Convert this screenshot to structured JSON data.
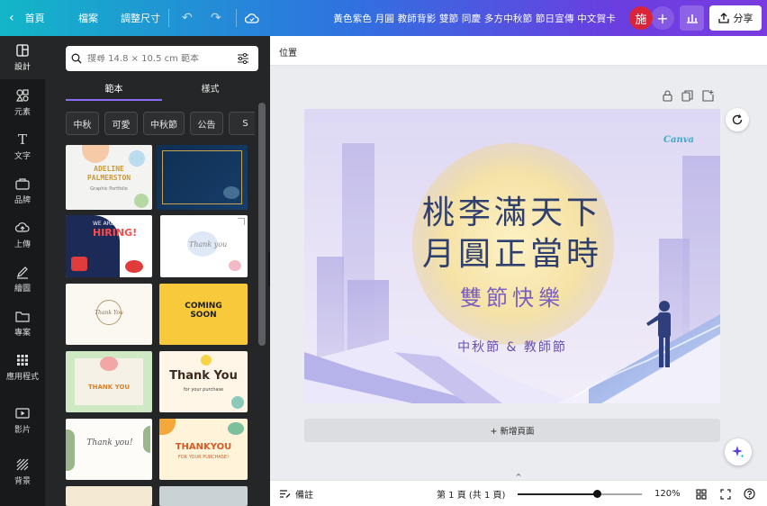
{
  "topbar": {
    "home_label": "首頁",
    "file_label": "檔案",
    "resize_label": "調整尺寸",
    "design_title": "黃色紫色 月圓 教師背影 雙節 同慶 多方中秋節 節日宣傳 中文賀卡",
    "avatar_initial": "施",
    "share_label": "分享"
  },
  "rail": {
    "items": [
      {
        "label": "設計",
        "icon": "layout-icon"
      },
      {
        "label": "元素",
        "icon": "shapes-icon"
      },
      {
        "label": "文字",
        "icon": "text-icon"
      },
      {
        "label": "品牌",
        "icon": "brand-icon"
      },
      {
        "label": "上傳",
        "icon": "upload-icon"
      },
      {
        "label": "繪圖",
        "icon": "draw-icon"
      },
      {
        "label": "專案",
        "icon": "folder-icon"
      },
      {
        "label": "應用程式",
        "icon": "apps-icon"
      },
      {
        "label": "影片",
        "icon": "video-icon"
      },
      {
        "label": "背景",
        "icon": "background-icon"
      }
    ]
  },
  "panel": {
    "search_placeholder": "搜尋 14.8 × 10.5 cm 範本",
    "tab_templates": "範本",
    "tab_styles": "樣式",
    "chips": [
      "中秋",
      "可愛",
      "中秋節",
      "公告",
      "S"
    ],
    "thumbs": {
      "adeline": "ADELINE PALMERSTON",
      "adeline_sub": "Graphic Portfolio",
      "hiring_top": "WE ARE",
      "hiring": "HIRING!",
      "thank_you_script": "Thank you",
      "thank_you_circle": "Thank You",
      "coming_soon": "COMING SOON",
      "thank_you_caps": "THANK YOU",
      "thank_you_bold": "Thank You",
      "thank_you_sub": "for your purchase",
      "thank_you_italic": "Thank you!",
      "thankyou_orange": "THANKYOU",
      "thankyou_orange_sub": "FOR YOUR PURCHASE!"
    }
  },
  "canvas": {
    "position_label": "位置",
    "headline_line1": "桃李滿天下",
    "headline_line2": "月圓正當時",
    "subtitle": "雙節快樂",
    "festival_line": "中秋節 & 教師節",
    "watermark": "Canva",
    "add_page_label": "+ 新增頁面"
  },
  "bottombar": {
    "notes_label": "備註",
    "page_indicator": "第 1 頁 (共 1 頁)",
    "zoom_label": "120%",
    "zoom_fraction": 0.64
  }
}
